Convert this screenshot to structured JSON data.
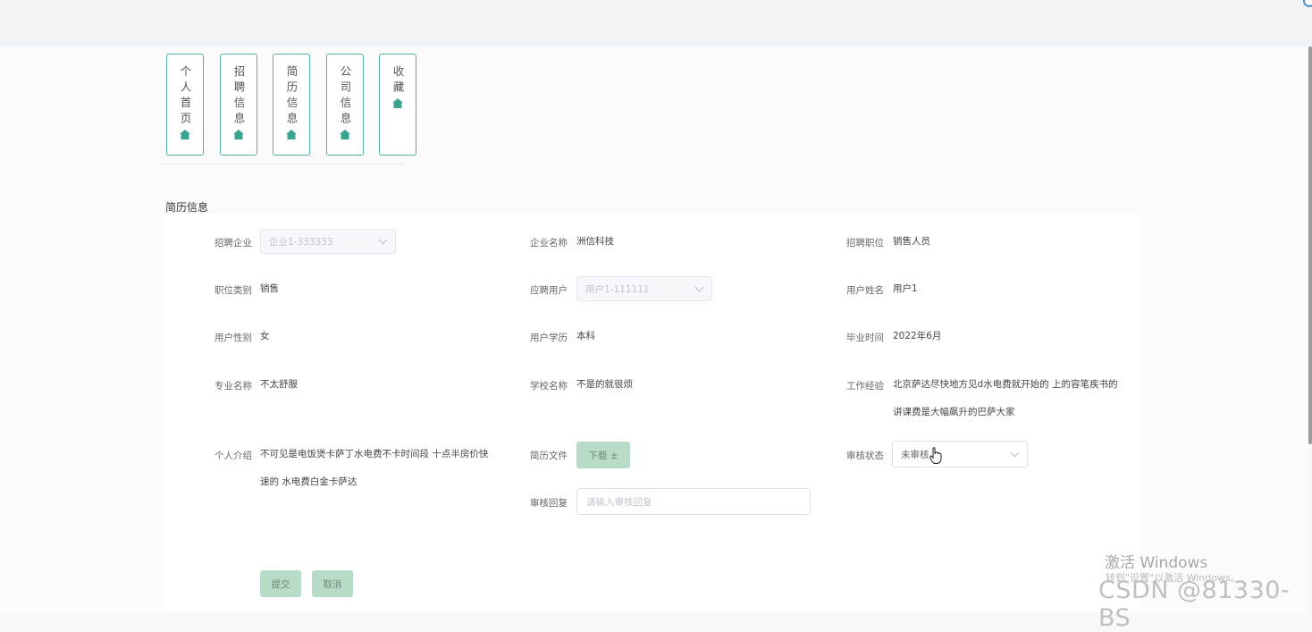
{
  "nav": {
    "items": [
      {
        "label": "个人首页",
        "icon": "home-icon"
      },
      {
        "label": "招聘信息",
        "icon": "home-icon"
      },
      {
        "label": "简历信息",
        "icon": "home-icon"
      },
      {
        "label": "公司信息",
        "icon": "home-icon"
      },
      {
        "label": "收藏",
        "icon": "home-icon"
      }
    ]
  },
  "section_title": "简历信息",
  "form": {
    "company_label": "招聘企业",
    "company_value": "企业1-333333",
    "company_name_label": "企业名称",
    "company_name_value": "洲信科技",
    "position_label": "招聘职位",
    "position_value": "销售人员",
    "job_category_label": "职位类别",
    "job_category_value": "销售",
    "applicant_label": "应聘用户",
    "applicant_value": "用户1-111111",
    "user_name_label": "用户姓名",
    "user_name_value": "用户1",
    "gender_label": "用户性别",
    "gender_value": "女",
    "education_label": "用户学历",
    "education_value": "本科",
    "graduation_label": "毕业时间",
    "graduation_value": "2022年6月",
    "major_label": "专业名称",
    "major_value": "不太舒服",
    "school_label": "学校名称",
    "school_value": "不是的就很烦",
    "experience_label": "工作经验",
    "experience_value": "北京萨达尽快地方见d水电费就开始的 上的容笔疾书的 讲课费是大幅飙升的巴萨大家",
    "intro_label": "个人介绍",
    "intro_value": "不可见是电饭煲卡萨丁水电费不卡时间段 十点半房价快速的 水电费白金卡萨达",
    "resume_file_label": "简历文件",
    "download_label": "下载 ±",
    "review_status_label": "审核状态",
    "review_status_value": "未审核",
    "review_reply_label": "审核回复",
    "review_reply_placeholder": "请输入审核回复",
    "submit_label": "提交",
    "cancel_label": "取消"
  },
  "watermark": {
    "activate_title": "激活 Windows",
    "activate_sub": "转到\"设置\"以激活 Windows。",
    "csdn": "CSDN @81330-BS"
  },
  "colors": {
    "accent": "#4fb3a6",
    "button_bg": "#b7dcc8"
  }
}
